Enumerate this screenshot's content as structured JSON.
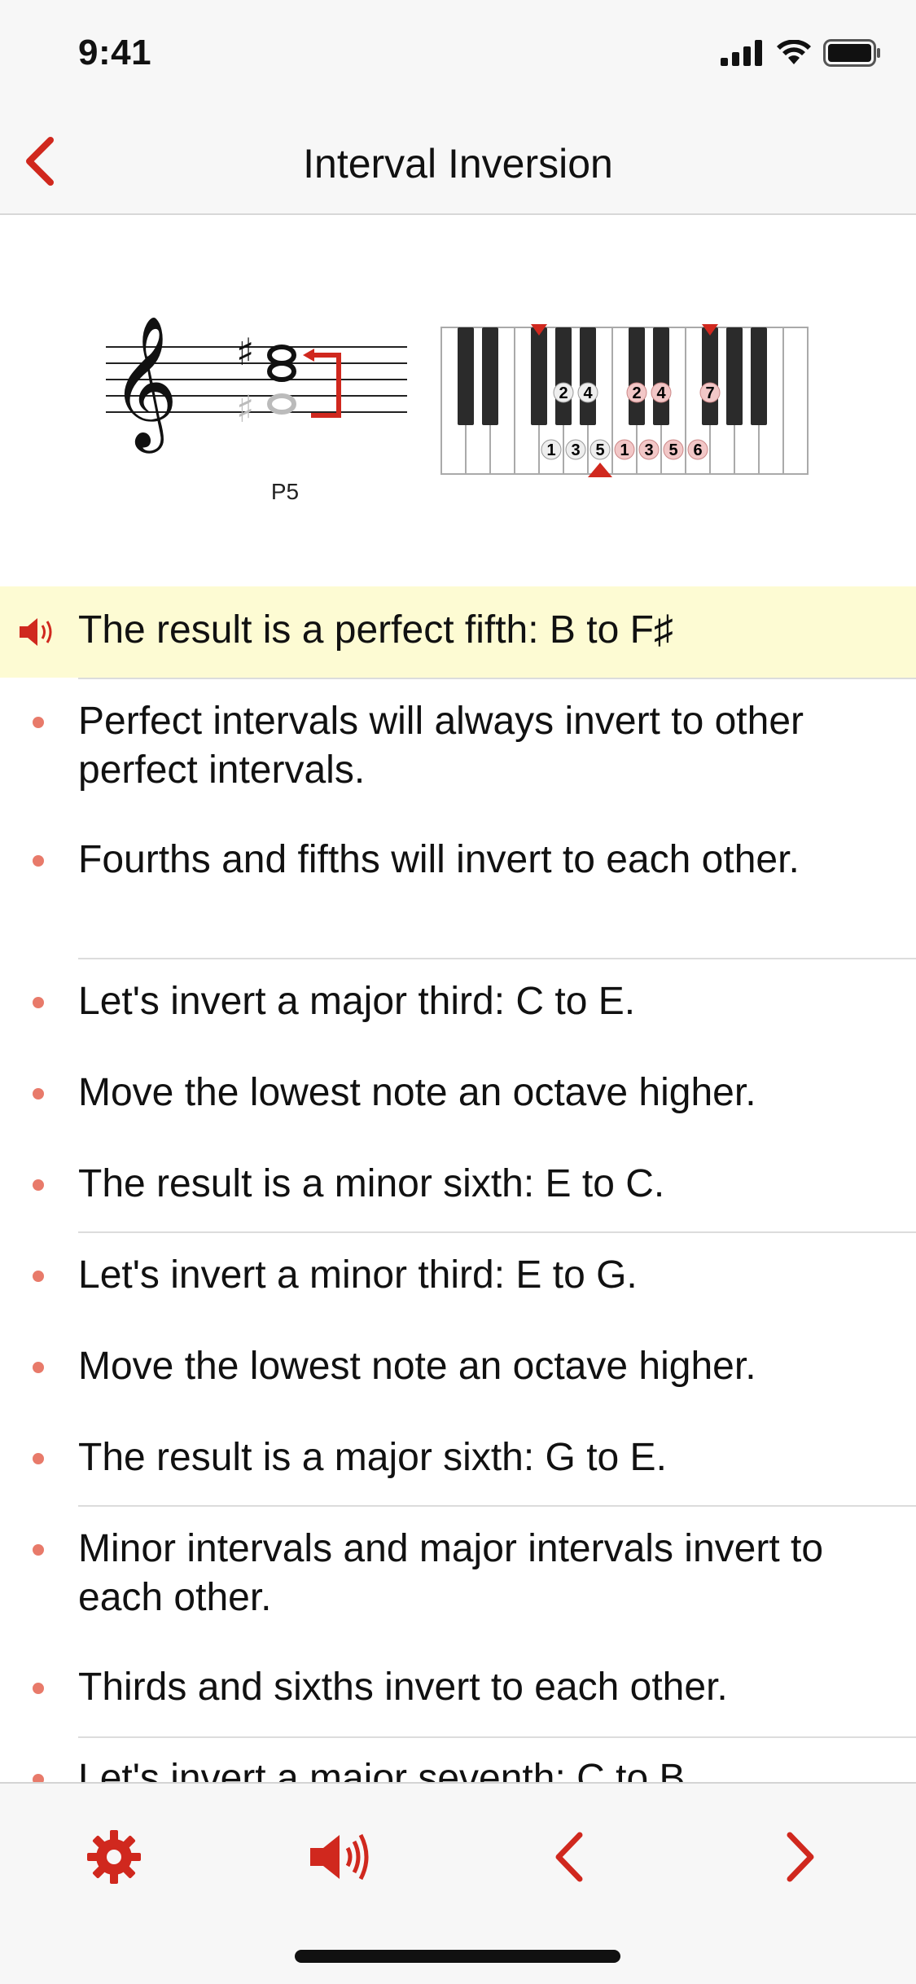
{
  "status_bar": {
    "time": "9:41"
  },
  "nav": {
    "title": "Interval Inversion"
  },
  "figure": {
    "interval_label": "P5",
    "finger_numbers_top": [
      "2",
      "4",
      "2",
      "4",
      "7"
    ],
    "finger_numbers_bottom": [
      "1",
      "3",
      "5",
      "1",
      "3",
      "5",
      "6"
    ]
  },
  "lines": [
    {
      "text": "The result is a perfect fifth: B to F♯",
      "active": true
    },
    {
      "text": "Perfect intervals will always invert to other perfect intervals."
    },
    {
      "text": "Fourths and fifths will invert to each other."
    },
    {
      "text": "Let's invert a major third: C to E."
    },
    {
      "text": "Move the lowest note an octave higher."
    },
    {
      "text": "The result is a minor sixth: E to C."
    },
    {
      "text": "Let's invert a minor third: E to G."
    },
    {
      "text": "Move the lowest note an octave higher."
    },
    {
      "text": "The result is a major sixth: G to E."
    },
    {
      "text": "Minor intervals and major intervals invert to each other."
    },
    {
      "text": "Thirds and sixths invert to each other."
    },
    {
      "text": "Let's invert a major seventh: C to B."
    }
  ],
  "colors": {
    "accent": "#d0281e",
    "highlight": "#fdfbd3",
    "bullet": "#e87a6a"
  },
  "tab_bar": {
    "icons": [
      "gear-icon",
      "speaker-icon",
      "chevron-left-icon",
      "chevron-right-icon"
    ]
  }
}
